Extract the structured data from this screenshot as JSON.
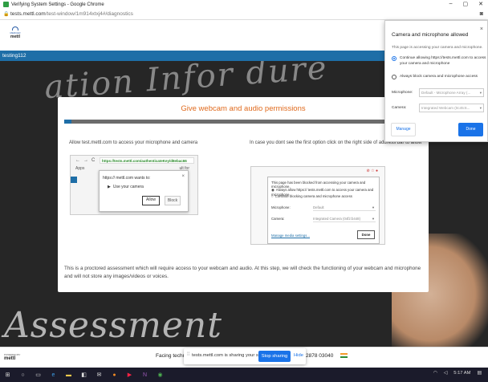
{
  "browser": {
    "window_title": "Verifying System Settings - Google Chrome",
    "url_host": "tests.mettl.com",
    "url_path": "/test-window/1m914xtxj4#/diagnostics",
    "window_controls": [
      "–",
      "▢",
      "✕"
    ]
  },
  "header": {
    "logo_tagline": "MERCER",
    "logo_name": "mettl",
    "candidate_name": "testing112"
  },
  "background": {
    "chalk_top": "ation Infor   dure",
    "chalk_bottom": "Assessment"
  },
  "card": {
    "title": "Give webcam and audio permissions",
    "progress_fraction": 0.02,
    "left_instruction": "Allow test.mettl.com to access your microphone and camera",
    "right_instruction": "In case you dont see the first option click on the right side of address bar to allow",
    "footer_text": "This is a proctored assessment which will require access to your webcam and audio. At this step, we will check the functioning of your webcam and microphone and will not store any images/videos or voices."
  },
  "example1": {
    "nav_icons": [
      "←",
      "→",
      "C"
    ],
    "address": "https://tests.mettl.com/authenticateKey/d8ebac66",
    "apps_label": "Apps",
    "apps_right": "ult for",
    "popup_title": "https:// mettl.com wants to:",
    "popup_item": "Use your camera",
    "allow_label": "Allow",
    "block_label": "Block"
  },
  "example2": {
    "panel_title": "This page has been blocked from accessing your camera and microphone.",
    "option_allow": "Always allow https:// tests.mettl.com to access your camera and microphone",
    "option_block": "Continue blocking camera and microphone access",
    "microphone_label": "Microphone:",
    "microphone_value": "Default",
    "camera_label": "Camera:",
    "camera_value": "Integrated Camera (04f2:b448)",
    "manage_label": "Manage media settings...",
    "done_label": "Done"
  },
  "camera_dialog": {
    "title": "Camera and microphone allowed",
    "subtitle": "This page is accessing your camera and microphone.",
    "option_continue": "Continue allowing https://tests.mettl.com to access your camera and microphone",
    "option_block": "Always block camera and microphone access",
    "microphone_label": "Microphone:",
    "microphone_value": "Default - Microphone Array (...",
    "camera_label": "Camera:",
    "camera_value": "Integrated Webcam (0c45:6...",
    "manage_label": "Manage",
    "done_label": "Done"
  },
  "bottombar": {
    "powered_by": "POWERED BY",
    "powered_name": "mettl",
    "facing_text": "Facing techni",
    "phone_text": "1 82878 03040"
  },
  "screen_share": {
    "grip": "⁞⁞",
    "message": "tests.mettl.com is sharing your screen.",
    "stop_label": "Stop sharing",
    "hide_label": "Hide"
  },
  "taskbar": {
    "time": "5:17 AM"
  }
}
